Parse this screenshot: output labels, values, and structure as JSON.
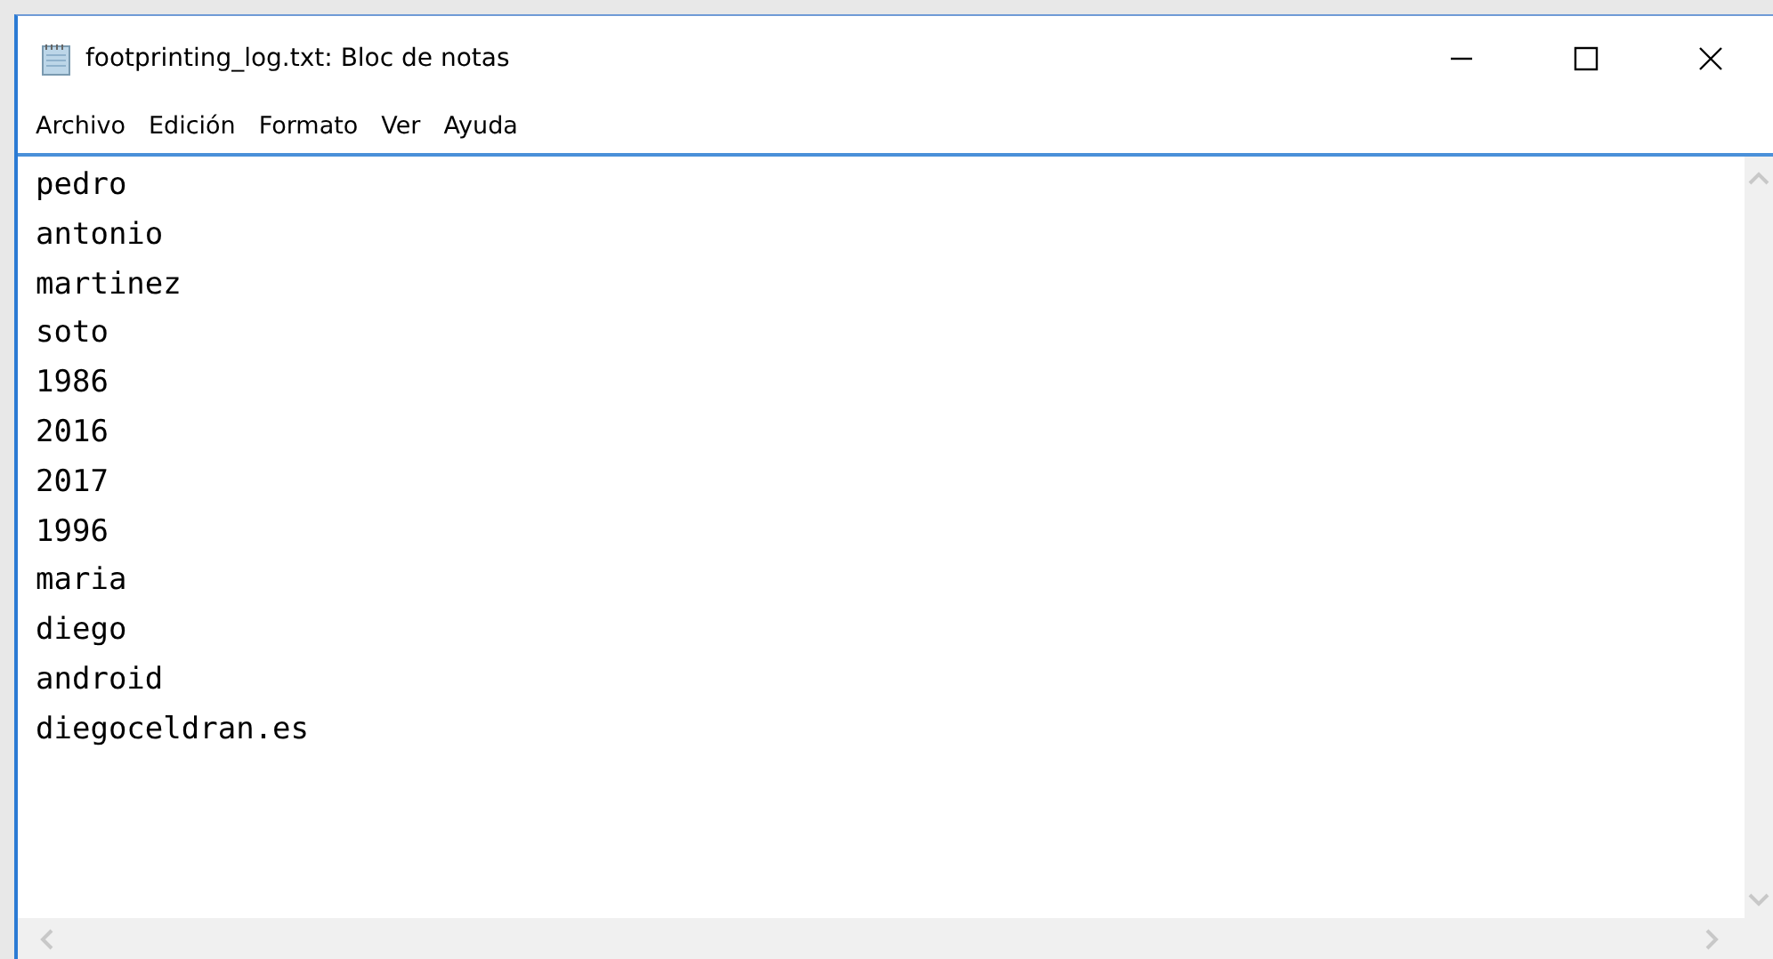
{
  "window": {
    "title": "footprinting_log.txt: Bloc de notas"
  },
  "menu": [
    "Archivo",
    "Edición",
    "Formato",
    "Ver",
    "Ayuda"
  ],
  "editor": {
    "lines": [
      "pedro",
      "antonio",
      "martinez",
      "soto",
      "1986",
      "2016",
      "2017",
      "1996",
      "maria",
      "diego",
      "android",
      "diegoceldran.es"
    ]
  }
}
